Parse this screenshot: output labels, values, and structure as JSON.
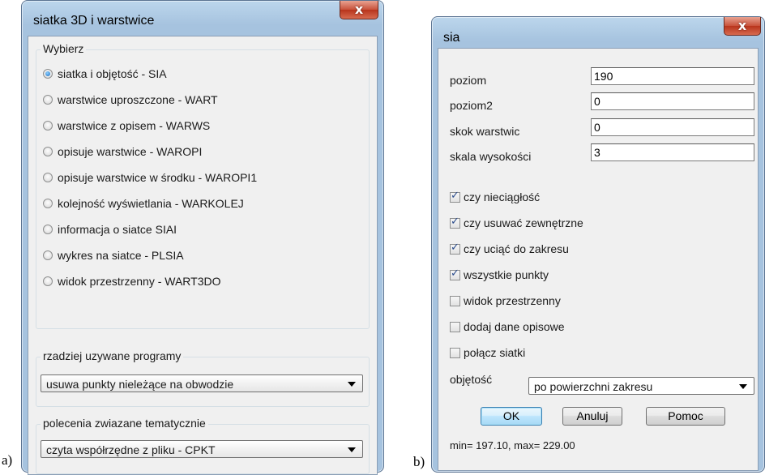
{
  "panels": {
    "a": "a)",
    "b": "b)"
  },
  "left_dialog": {
    "title": "siatka 3D i warstwice",
    "close_glyph": "x",
    "group_choose": "Wybierz",
    "options": [
      {
        "label": "siatka i objętość - SIA",
        "selected": true
      },
      {
        "label": "warstwice uproszczone - WART",
        "selected": false
      },
      {
        "label": "warstwice z opisem - WARWS",
        "selected": false
      },
      {
        "label": "opisuje warstwice - WAROPI",
        "selected": false
      },
      {
        "label": "opisuje warstwice w środku - WAROPI1",
        "selected": false
      },
      {
        "label": "kolejność wyświetlania - WARKOLEJ",
        "selected": false
      },
      {
        "label": "informacja o siatce SIAI",
        "selected": false
      },
      {
        "label": "wykres na siatce - PLSIA",
        "selected": false
      },
      {
        "label": "widok przestrzenny - WART3DO",
        "selected": false
      }
    ],
    "group_rare": "rzadziej uzywane programy",
    "rare_value": "usuwa punkty nieleżące na obwodzie",
    "group_topic": "polecenia zwiazane tematycznie",
    "topic_value": "czyta współrzędne z pliku - CPKT"
  },
  "right_dialog": {
    "title": "sia",
    "close_glyph": "x",
    "fields": [
      {
        "label": "poziom",
        "value": "190"
      },
      {
        "label": "poziom2",
        "value": "0"
      },
      {
        "label": "skok warstwic",
        "value": "0"
      },
      {
        "label": "skala wysokości",
        "value": "3"
      }
    ],
    "checkboxes": [
      {
        "label": "czy nieciągłość",
        "checked": true
      },
      {
        "label": "czy usuwać zewnętrzne",
        "checked": true
      },
      {
        "label": "czy uciąć do zakresu",
        "checked": true
      },
      {
        "label": "wszystkie punkty",
        "checked": true
      },
      {
        "label": "widok przestrzenny",
        "checked": false
      },
      {
        "label": "dodaj dane opisowe",
        "checked": false
      },
      {
        "label": "połącz siatki",
        "checked": false
      }
    ],
    "volume_label": "objętość",
    "volume_value": "po powierzchni zakresu",
    "ok_label": "OK",
    "cancel_label": "Anuluj",
    "help_label": "Pomoc",
    "status": "min= 197.10, max= 229.00"
  }
}
